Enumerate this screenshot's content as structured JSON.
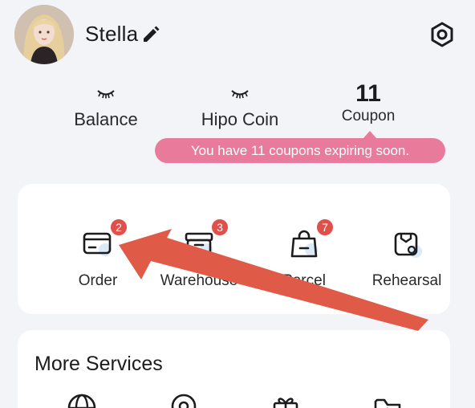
{
  "profile": {
    "username": "Stella",
    "edit_icon": "pencil-icon",
    "settings_icon": "hexagon-gear-icon"
  },
  "stats": {
    "balance": {
      "value_icon": "closed-eye-icon",
      "label": "Balance"
    },
    "hipo_coin": {
      "value_icon": "closed-eye-icon",
      "label": "Hipo Coin"
    },
    "coupon": {
      "value": "11",
      "label": "Coupon"
    }
  },
  "tooltip": {
    "text": "You have 11 coupons expiring soon."
  },
  "orders": {
    "items": [
      {
        "label": "Order",
        "badge": "2",
        "icon": "card-icon"
      },
      {
        "label": "Warehouse",
        "badge": "3",
        "icon": "box-icon"
      },
      {
        "label": "Parcel",
        "badge": "7",
        "icon": "bag-icon"
      },
      {
        "label": "Rehearsal",
        "badge": "",
        "icon": "package-check-icon"
      }
    ]
  },
  "more_services": {
    "title": "More Services",
    "icons": [
      "globe-icon",
      "location-icon",
      "gift-icon",
      "folder-icon"
    ]
  },
  "colors": {
    "accent_pink": "#e87a9c",
    "badge_red": "#e0504a",
    "annotation_arrow": "#e05a48",
    "background": "#f2f4f7"
  }
}
